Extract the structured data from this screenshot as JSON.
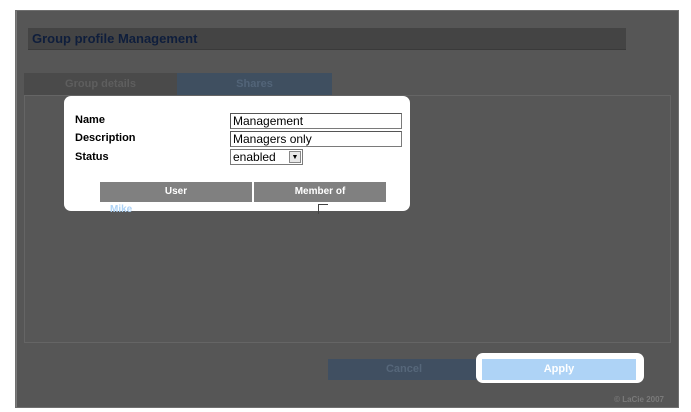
{
  "page": {
    "title": "Group profile Management",
    "copyright": "© LaCie 2007"
  },
  "tabs": [
    {
      "label": "Group details"
    },
    {
      "label": "Shares"
    }
  ],
  "form": {
    "name_label": "Name",
    "name_value": "Management",
    "description_label": "Description",
    "description_value": "Managers only",
    "status_label": "Status",
    "status_value": "enabled"
  },
  "table": {
    "columns": [
      "User",
      "Member of"
    ],
    "rows": [
      {
        "user": "Mike",
        "member_of": false
      }
    ]
  },
  "buttons": {
    "cancel": "Cancel",
    "apply": "Apply"
  },
  "colors": {
    "overlay": "#565656",
    "link": "#aed3f6",
    "apply_button": "#aed3f6"
  }
}
